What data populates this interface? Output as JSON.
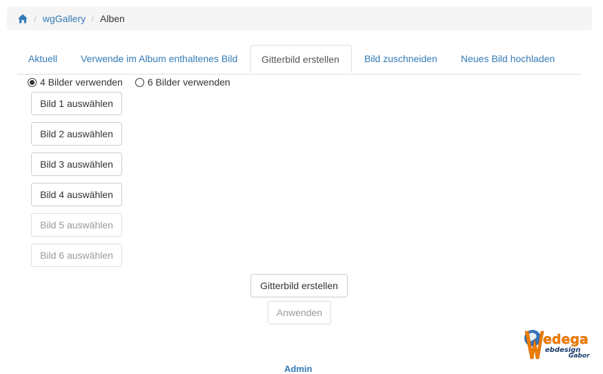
{
  "breadcrumb": {
    "home_icon": "home-icon",
    "items": [
      {
        "label": "wgGallery"
      },
      {
        "label": "Alben"
      }
    ]
  },
  "tabs": [
    {
      "label": "Aktuell",
      "active": false
    },
    {
      "label": "Verwende im Album enthaltenes Bild",
      "active": false
    },
    {
      "label": "Gitterbild erstellen",
      "active": true
    },
    {
      "label": "Bild zuschneiden",
      "active": false
    },
    {
      "label": "Neues Bild hochladen",
      "active": false
    }
  ],
  "grid_options": [
    {
      "label": "4 Bilder verwenden",
      "checked": true
    },
    {
      "label": "6 Bilder verwenden",
      "checked": false
    }
  ],
  "image_buttons": [
    {
      "label": "Bild 1 auswählen",
      "enabled": true
    },
    {
      "label": "Bild 2 auswählen",
      "enabled": true
    },
    {
      "label": "Bild 3 auswählen",
      "enabled": true
    },
    {
      "label": "Bild 4 auswählen",
      "enabled": true
    },
    {
      "label": "Bild 5 auswählen",
      "enabled": false
    },
    {
      "label": "Bild 6 auswählen",
      "enabled": false
    }
  ],
  "actions": {
    "create_label": "Gitterbild erstellen",
    "apply_label": "Anwenden",
    "apply_enabled": false
  },
  "footer": {
    "logo_text": "edega",
    "logo_sub1": "ebdesign",
    "logo_sub2": "Gabor",
    "admin_link": "Admin"
  },
  "colors": {
    "link": "#337ab7",
    "logo_orange": "#f07d00"
  }
}
